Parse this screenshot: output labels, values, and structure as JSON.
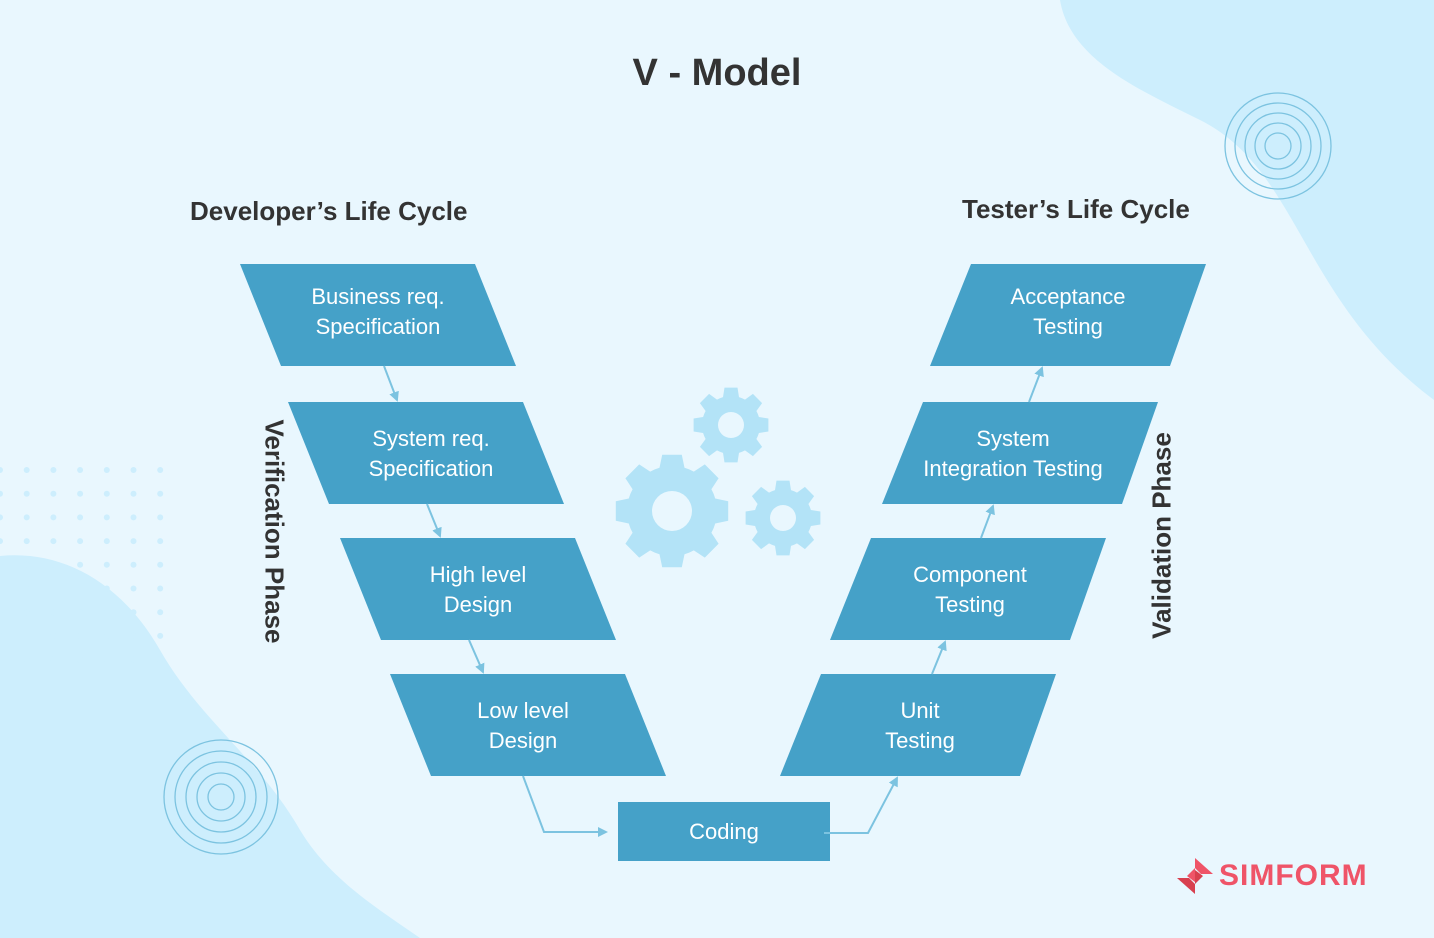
{
  "title": "V - Model",
  "developer_label": "Developer’s Life Cycle",
  "tester_label": "Tester’s Life Cycle",
  "verification_label": "Verification Phase",
  "validation_label": "Validation Phase",
  "left_steps": [
    {
      "line1": "Business req.",
      "line2": "Specification"
    },
    {
      "line1": "System req.",
      "line2": "Specification"
    },
    {
      "line1": "High level",
      "line2": "Design"
    },
    {
      "line1": "Low level",
      "line2": "Design"
    }
  ],
  "right_steps": [
    {
      "line1": "Acceptance",
      "line2": "Testing"
    },
    {
      "line1": "System",
      "line2": "Integration Testing"
    },
    {
      "line1": "Component",
      "line2": "Testing"
    },
    {
      "line1": "Unit",
      "line2": "Testing"
    }
  ],
  "bottom_step": "Coding",
  "brand": "SIMFORM",
  "colors": {
    "box": "#45a1c8",
    "arrow": "#7cc3e0",
    "gear": "#b3e3f7",
    "brand": "#ef5468",
    "blob": "#cdeefd"
  }
}
